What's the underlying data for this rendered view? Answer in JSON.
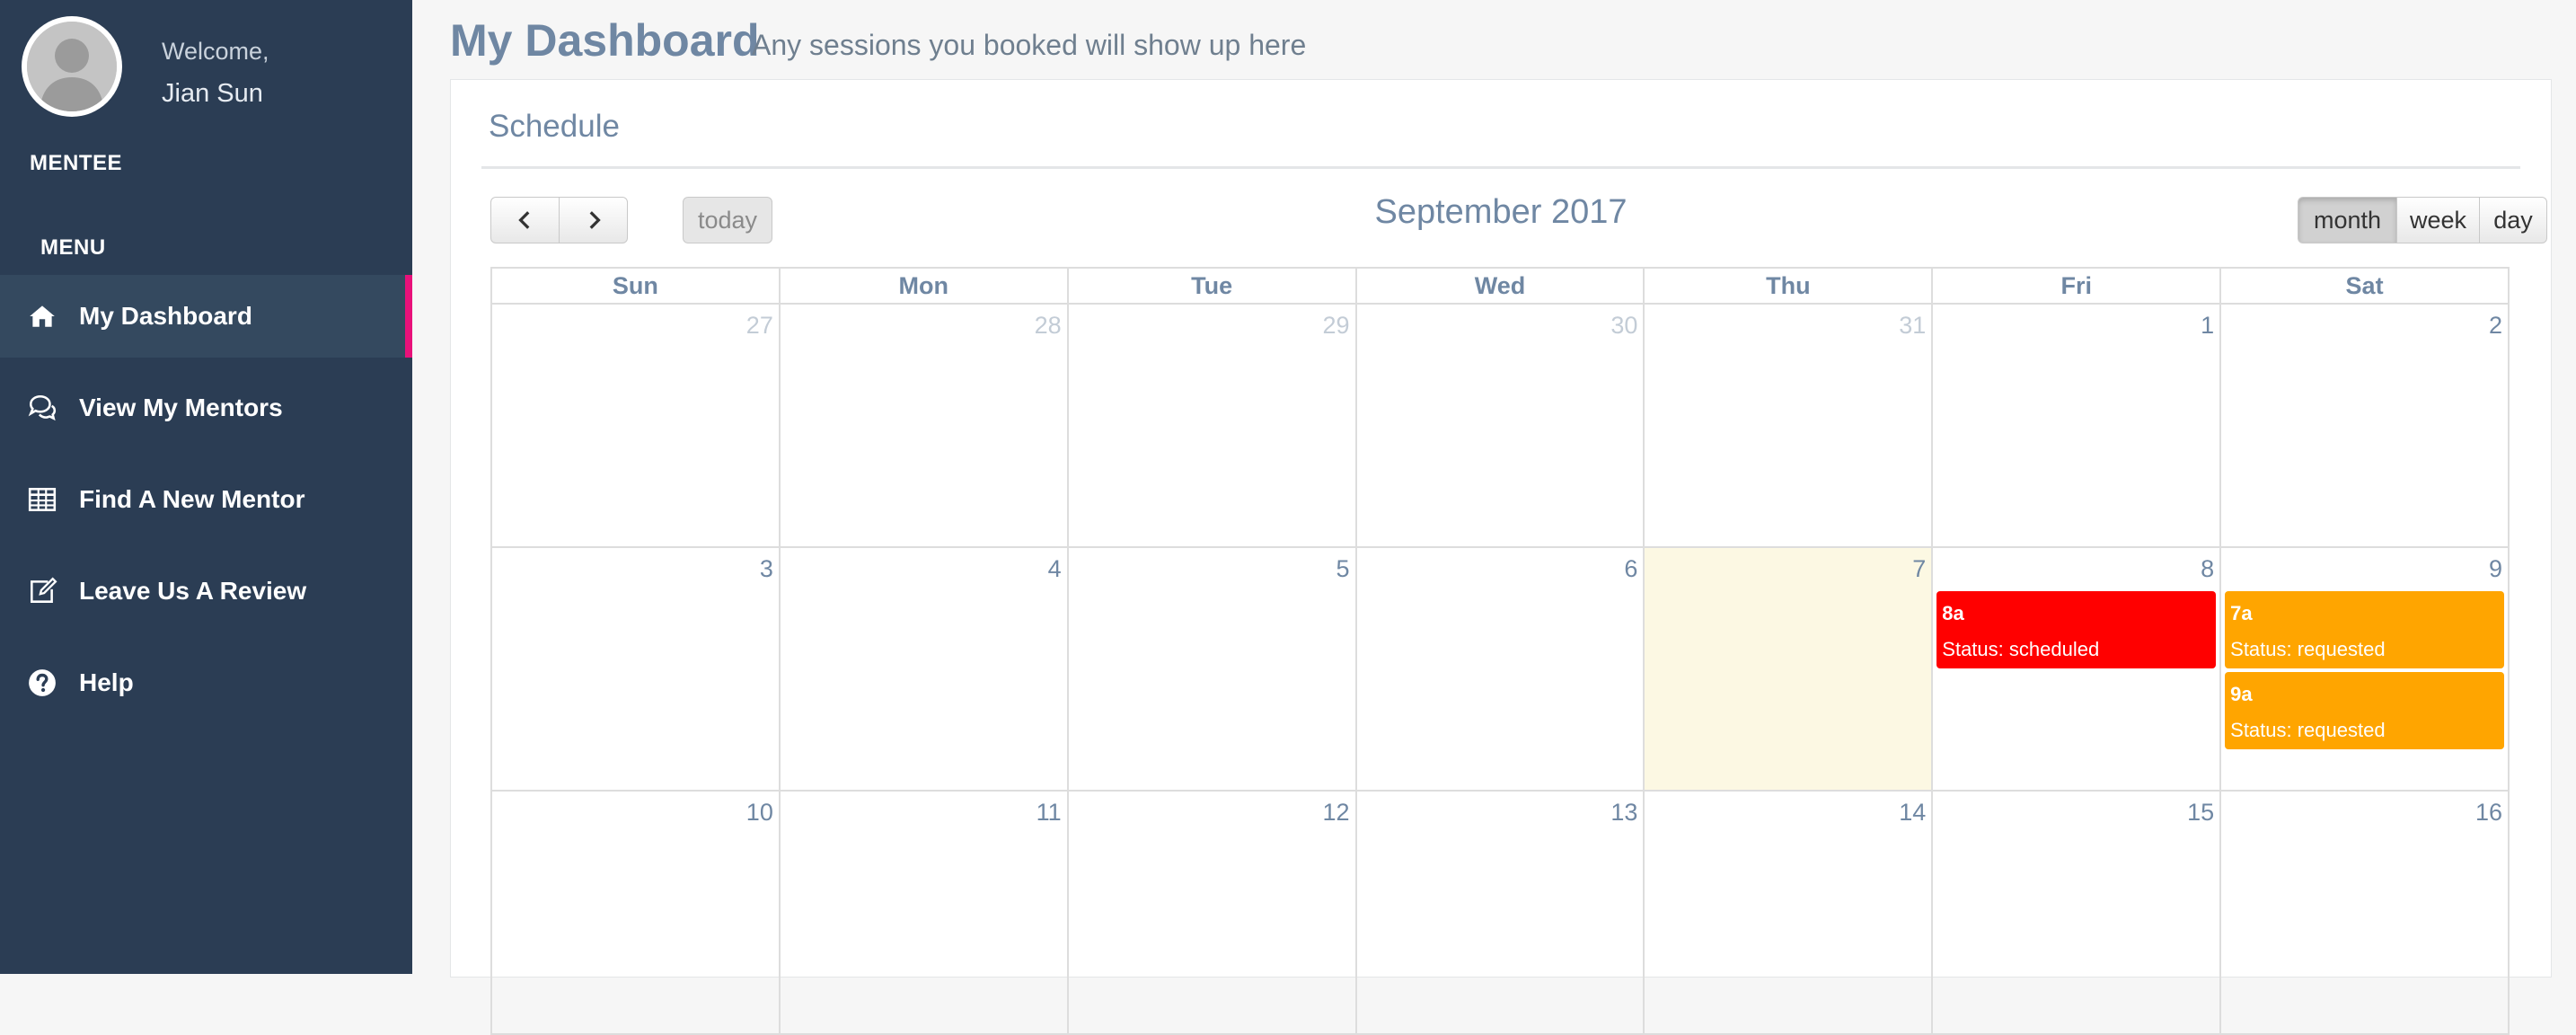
{
  "sidebar": {
    "welcome": "Welcome,",
    "username": "Jian Sun",
    "role": "MENTEE",
    "menu_heading": "MENU",
    "items": [
      {
        "label": "My Dashboard",
        "icon": "home-icon",
        "active": true
      },
      {
        "label": "View My Mentors",
        "icon": "comments-icon",
        "active": false
      },
      {
        "label": "Find A New Mentor",
        "icon": "table-icon",
        "active": false
      },
      {
        "label": "Leave Us A Review",
        "icon": "edit-icon",
        "active": false
      },
      {
        "label": "Help",
        "icon": "question-circle-icon",
        "active": false
      }
    ],
    "active_accent": "#e8117a"
  },
  "header": {
    "title": "My Dashboard",
    "subtitle": "Any sessions you booked will show up here"
  },
  "schedule": {
    "panel_title": "Schedule",
    "calendar_title": "September 2017",
    "buttons": {
      "prev_icon": "chevron-left-icon",
      "next_icon": "chevron-right-icon",
      "today": "today",
      "month": "month",
      "week": "week",
      "day": "day",
      "active_view": "month"
    },
    "weekdays": [
      "Sun",
      "Mon",
      "Tue",
      "Wed",
      "Thu",
      "Fri",
      "Sat"
    ],
    "weeks": [
      [
        "27",
        "28",
        "29",
        "30",
        "31",
        "1",
        "2"
      ],
      [
        "3",
        "4",
        "5",
        "6",
        "7",
        "8",
        "9"
      ],
      [
        "10",
        "11",
        "12",
        "13",
        "14",
        "15",
        "16"
      ]
    ],
    "today_date": "7",
    "events": {
      "fri_8": [
        {
          "time": "8a",
          "status": "Status: scheduled",
          "color": "#ff0000"
        }
      ],
      "sat_9": [
        {
          "time": "7a",
          "status": "Status: requested",
          "color": "#ffa500"
        },
        {
          "time": "9a",
          "status": "Status: requested",
          "color": "#ffa500"
        }
      ]
    }
  }
}
